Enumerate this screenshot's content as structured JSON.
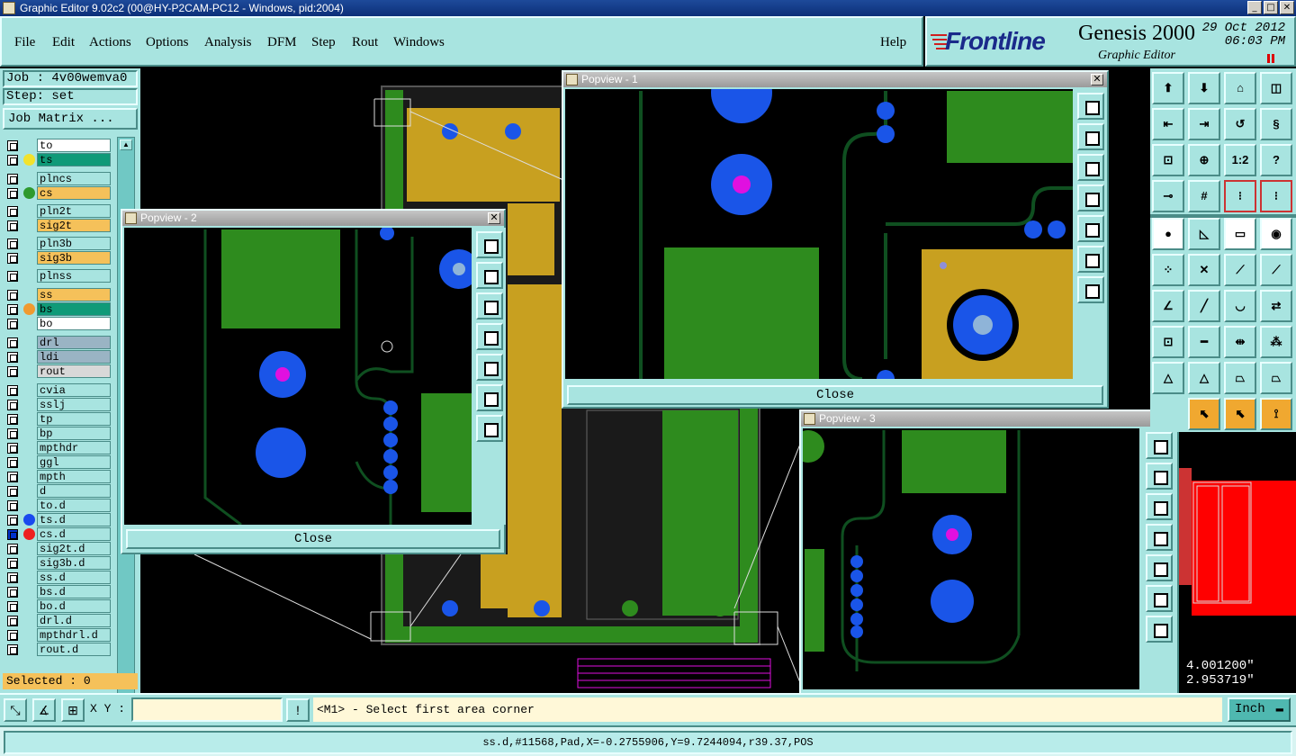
{
  "window": {
    "title": "Graphic Editor 9.02c2 (00@HY-P2CAM-PC12 - Windows, pid:2004)"
  },
  "menu": [
    "File",
    "Edit",
    "Actions",
    "Options",
    "Analysis",
    "DFM",
    "Step",
    "Rout",
    "Windows"
  ],
  "help_label": "Help",
  "brand": {
    "logo": "Frontline",
    "product": "Genesis 2000",
    "subtitle": "Graphic Editor",
    "date": "29 Oct 2012",
    "time": "06:03 PM"
  },
  "job": {
    "job_label": "Job : 4v00wemva0",
    "step_label": "Step: set",
    "matrix_button": "Job Matrix ..."
  },
  "layers": [
    {
      "name": "to",
      "bg": "#ffffff",
      "dot": ""
    },
    {
      "name": "ts",
      "bg": "#0f9a78",
      "dot": "#f2e22c"
    },
    {
      "name": "plncs",
      "bg": "#a8e4e0",
      "dot": ""
    },
    {
      "name": "cs",
      "bg": "#f5c15a",
      "dot": "#2e9a2e"
    },
    {
      "name": "pln2t",
      "bg": "#a8e4e0",
      "dot": ""
    },
    {
      "name": "sig2t",
      "bg": "#f5c15a",
      "dot": ""
    },
    {
      "name": "pln3b",
      "bg": "#a8e4e0",
      "dot": ""
    },
    {
      "name": "sig3b",
      "bg": "#f5c15a",
      "dot": ""
    },
    {
      "name": "plnss",
      "bg": "#a8e4e0",
      "dot": ""
    },
    {
      "name": "ss",
      "bg": "#f5c15a",
      "dot": ""
    },
    {
      "name": "bs",
      "bg": "#0f9a78",
      "dot": "#f09a30"
    },
    {
      "name": "bo",
      "bg": "#ffffff",
      "dot": ""
    },
    {
      "name": "drl",
      "bg": "#9ab4c4",
      "dot": ""
    },
    {
      "name": "ldi",
      "bg": "#9ab4c4",
      "dot": ""
    },
    {
      "name": "rout",
      "bg": "#d8d8d8",
      "dot": ""
    },
    {
      "name": "cvia",
      "bg": "#a8e4e0",
      "dot": ""
    },
    {
      "name": "sslj",
      "bg": "#a8e4e0",
      "dot": ""
    },
    {
      "name": "tp",
      "bg": "#a8e4e0",
      "dot": ""
    },
    {
      "name": "bp",
      "bg": "#a8e4e0",
      "dot": ""
    },
    {
      "name": "mpthdr",
      "bg": "#a8e4e0",
      "dot": ""
    },
    {
      "name": "ggl",
      "bg": "#a8e4e0",
      "dot": ""
    },
    {
      "name": "mpth",
      "bg": "#a8e4e0",
      "dot": ""
    },
    {
      "name": "d",
      "bg": "#a8e4e0",
      "dot": ""
    },
    {
      "name": "to.d",
      "bg": "#a8e4e0",
      "dot": ""
    },
    {
      "name": "ts.d",
      "bg": "#a8e4e0",
      "dot": "#1a4aee"
    },
    {
      "name": "cs.d",
      "bg": "#a8e4e0",
      "dot": "#ee2020",
      "checked": true
    },
    {
      "name": "sig2t.d",
      "bg": "#a8e4e0",
      "dot": ""
    },
    {
      "name": "sig3b.d",
      "bg": "#a8e4e0",
      "dot": ""
    },
    {
      "name": "ss.d",
      "bg": "#a8e4e0",
      "dot": ""
    },
    {
      "name": "bs.d",
      "bg": "#a8e4e0",
      "dot": ""
    },
    {
      "name": "bo.d",
      "bg": "#a8e4e0",
      "dot": ""
    },
    {
      "name": "drl.d",
      "bg": "#a8e4e0",
      "dot": ""
    },
    {
      "name": "mpthdrl.d",
      "bg": "#a8e4e0",
      "dot": ""
    },
    {
      "name": "rout.d",
      "bg": "#a8e4e0",
      "dot": ""
    }
  ],
  "selected_label": "Selected : 0",
  "popviews": {
    "p1": "Popview - 1",
    "p2": "Popview - 2",
    "p3": "Popview - 3",
    "close": "Close"
  },
  "tools_right": {
    "ratio_label": "1:2",
    "help_q": "?"
  },
  "coords": {
    "x": "4.001200\"",
    "y": "2.953719\""
  },
  "bottom": {
    "xy_label": "X Y :",
    "excl": "!",
    "message": "<M1> - Select first area corner",
    "unit": "Inch"
  },
  "status": "ss.d,#11568,Pad,X=-0.2755906,Y=9.7244094,r39.37,POS",
  "colors": {
    "panel": "#a8e4e0",
    "board_green": "#2e8b1e",
    "copper": "#c8a020",
    "pad_blue": "#1a55e8",
    "pad_magenta": "#e010e0",
    "trace": "#0f4f20"
  }
}
